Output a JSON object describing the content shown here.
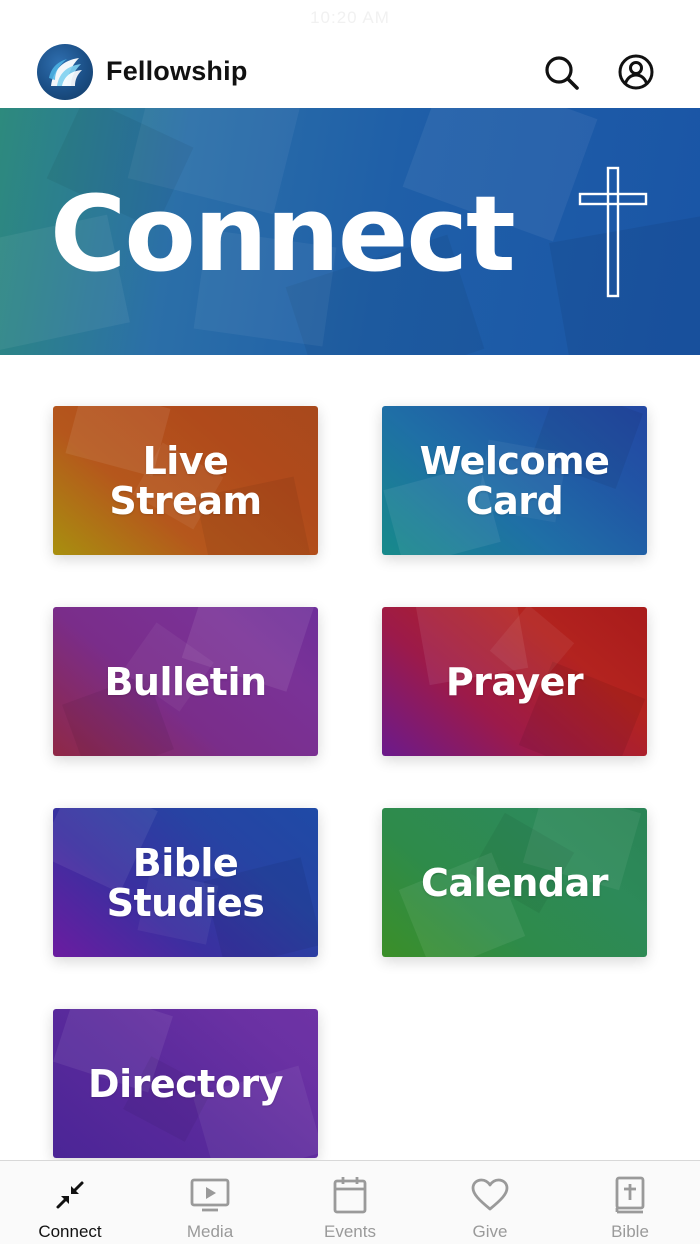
{
  "status_bar": {
    "time": "10:20 AM"
  },
  "header": {
    "title": "Fellowship",
    "logo_icon": "fellowship-logo",
    "search_icon": "search-icon",
    "account_icon": "account-circle-icon"
  },
  "hero": {
    "title": "Connect",
    "icon": "cross-icon",
    "accent": "#1f5fa8"
  },
  "tiles": [
    {
      "label": "Live\nStream",
      "color": "#b04a1b"
    },
    {
      "label": "Welcome\nCard",
      "color": "#2154a5"
    },
    {
      "label": "Bulletin",
      "color": "#7a3297"
    },
    {
      "label": "Prayer",
      "color": "#a81b1b"
    },
    {
      "label": "Bible\nStudies",
      "color": "#2644a3"
    },
    {
      "label": "Calendar",
      "color": "#2a8456"
    },
    {
      "label": "Directory",
      "color": "#6a31a3"
    }
  ],
  "tab_bar": {
    "active": "Connect",
    "tabs": [
      {
        "label": "Connect",
        "icon": "connect-arrows-icon"
      },
      {
        "label": "Media",
        "icon": "media-play-icon"
      },
      {
        "label": "Events",
        "icon": "calendar-icon"
      },
      {
        "label": "Give",
        "icon": "heart-icon"
      },
      {
        "label": "Bible",
        "icon": "bible-book-icon"
      }
    ]
  }
}
